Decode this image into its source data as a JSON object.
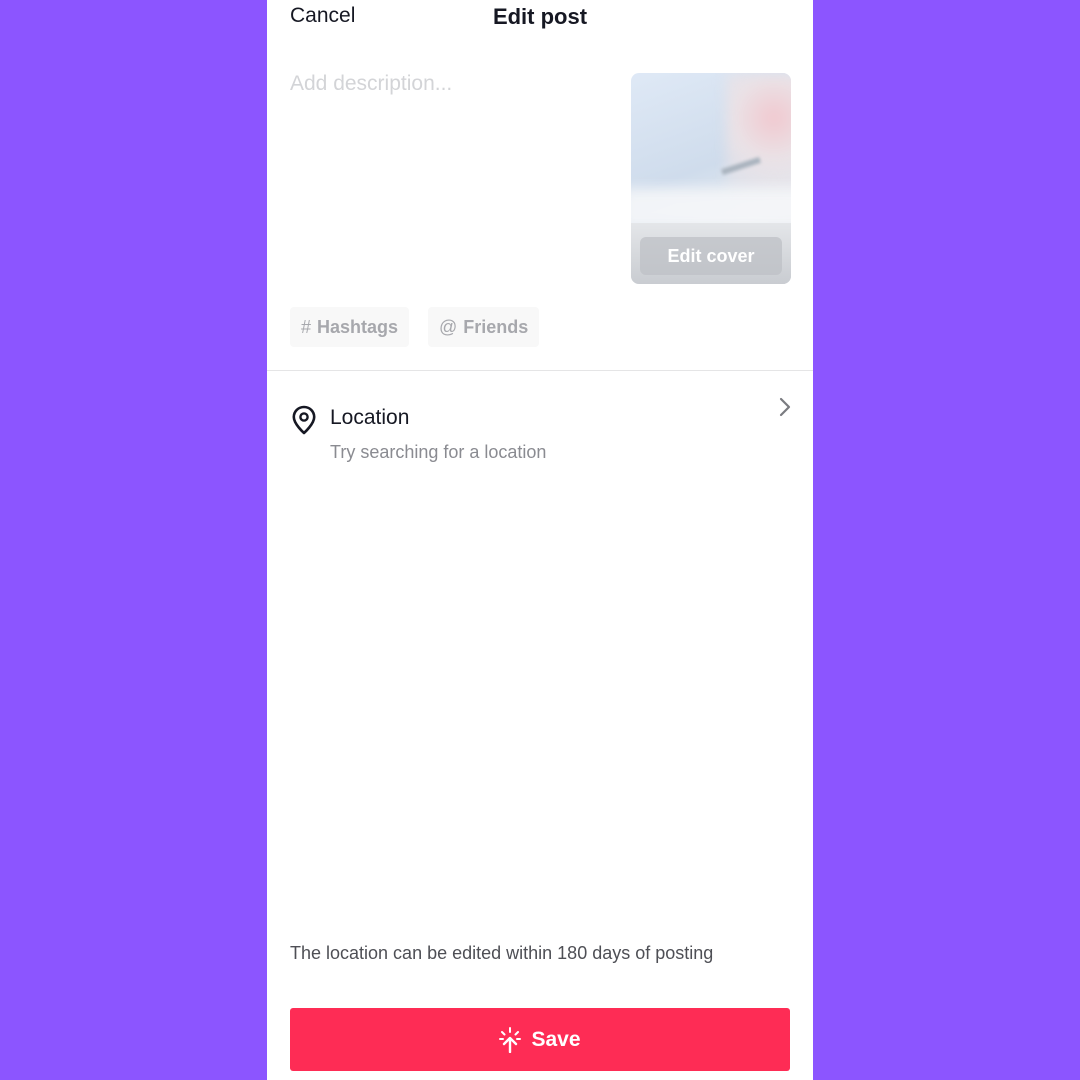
{
  "header": {
    "cancel_label": "Cancel",
    "title": "Edit post"
  },
  "description": {
    "value": "",
    "placeholder": "Add description..."
  },
  "cover": {
    "edit_label": "Edit cover"
  },
  "chips": [
    {
      "symbol": "#",
      "label": "Hashtags",
      "icon": "hashtag-icon"
    },
    {
      "symbol": "@",
      "label": "Friends",
      "icon": "at-sign-icon"
    }
  ],
  "location": {
    "icon": "location-pin-icon",
    "title": "Location",
    "subtitle": "Try searching for a location",
    "chevron_icon": "chevron-right-icon"
  },
  "note": "The location can be edited within 180 days of posting",
  "save": {
    "label": "Save",
    "icon": "upload-sparkle-icon"
  },
  "colors": {
    "background": "#8c55ff",
    "accent": "#fe2c55",
    "text": "#161823",
    "muted": "#8a8b91"
  }
}
